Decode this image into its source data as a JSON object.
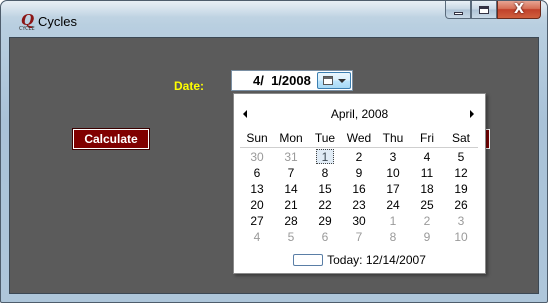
{
  "window": {
    "title": "Cycles",
    "icon": "app-logo-icon",
    "icon_sub": "CYCLE",
    "close_label": "X"
  },
  "form": {
    "date_label": "Date:",
    "date_value": "4/  1/2008",
    "calculate_label": "Calculate"
  },
  "calendar": {
    "month_label": "April, 2008",
    "days_of_week": [
      "Sun",
      "Mon",
      "Tue",
      "Wed",
      "Thu",
      "Fri",
      "Sat"
    ],
    "weeks": [
      [
        "30",
        "31",
        "1",
        "2",
        "3",
        "4",
        "5"
      ],
      [
        "6",
        "7",
        "8",
        "9",
        "10",
        "11",
        "12"
      ],
      [
        "13",
        "14",
        "15",
        "16",
        "17",
        "18",
        "19"
      ],
      [
        "20",
        "21",
        "22",
        "23",
        "24",
        "25",
        "26"
      ],
      [
        "27",
        "28",
        "29",
        "30",
        "1",
        "2",
        "3"
      ],
      [
        "4",
        "5",
        "6",
        "7",
        "8",
        "9",
        "10"
      ]
    ],
    "selected_day": "1",
    "today_label": "Today: 12/14/2007"
  },
  "colors": {
    "client_bg": "#5b5b5b",
    "label_yellow": "#ffff00",
    "button_maroon": "#800000"
  }
}
